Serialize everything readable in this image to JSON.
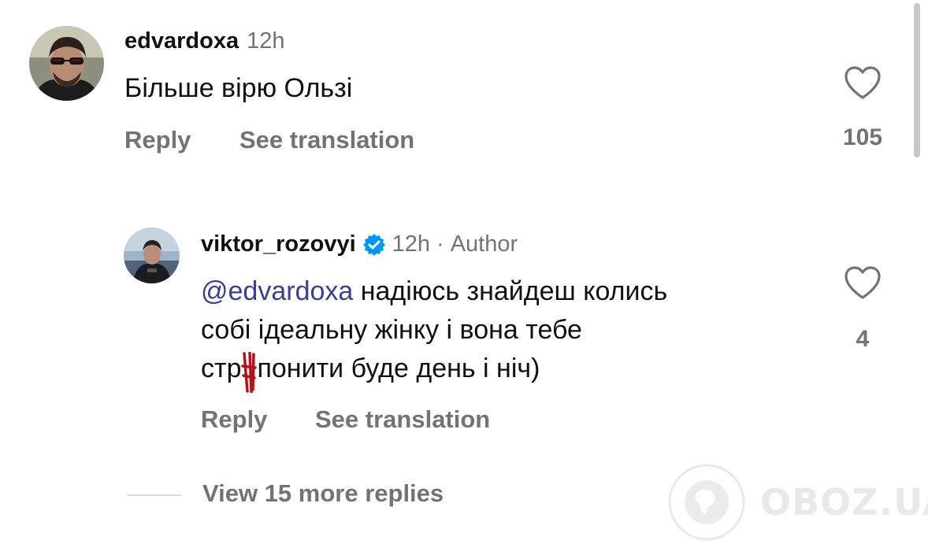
{
  "comment": {
    "username": "edvardoxa",
    "time": "12h",
    "text": "Більше вірю Ользі",
    "reply_label": "Reply",
    "translate_label": "See translation",
    "like_count": "105"
  },
  "reply": {
    "username": "viktor_rozovyi",
    "verified": true,
    "time": "12h",
    "separator": "·",
    "author_badge": "Author",
    "mention": "@edvardoxa",
    "text_line1": " надіюсь знайдеш колись",
    "text_line2": "собі ідеальну жінку і вона тебе",
    "text_line3_before": "стр",
    "text_line3_after": "понити буде день і ніч)",
    "reply_label": "Reply",
    "translate_label": "See translation",
    "like_count": "4"
  },
  "more_replies_label": "View 15 more replies",
  "watermark": "OBOZ.UA",
  "colors": {
    "secondary_text": "#737373",
    "mention": "#3b3f8f",
    "verified_badge": "#0095f6",
    "censor_mark": "#b3121c"
  },
  "icons": [
    "heart-outline-icon",
    "verified-badge-icon",
    "globe-logo-icon"
  ]
}
